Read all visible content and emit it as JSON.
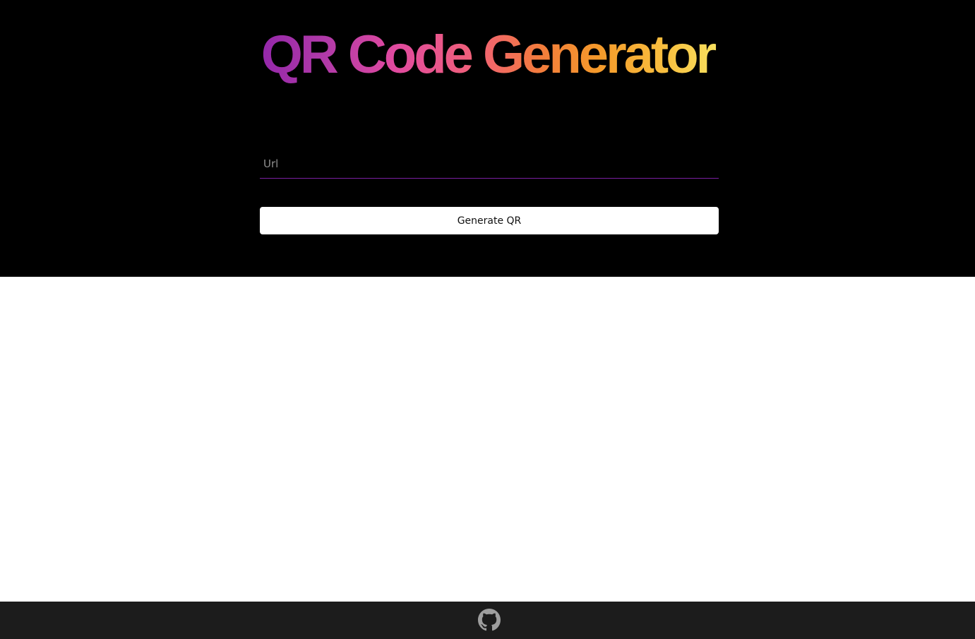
{
  "header": {
    "title": "QR Code Generator",
    "title_gradient": [
      "#8e24aa",
      "#e04aa0",
      "#f37c3c",
      "#f8ec6a"
    ]
  },
  "form": {
    "url_placeholder": "Url",
    "url_value": "",
    "underline_color": "#7b1fa2",
    "generate_label": "Generate QR"
  },
  "footer": {
    "icon": "github-icon",
    "icon_color": "#9e9e9e"
  }
}
